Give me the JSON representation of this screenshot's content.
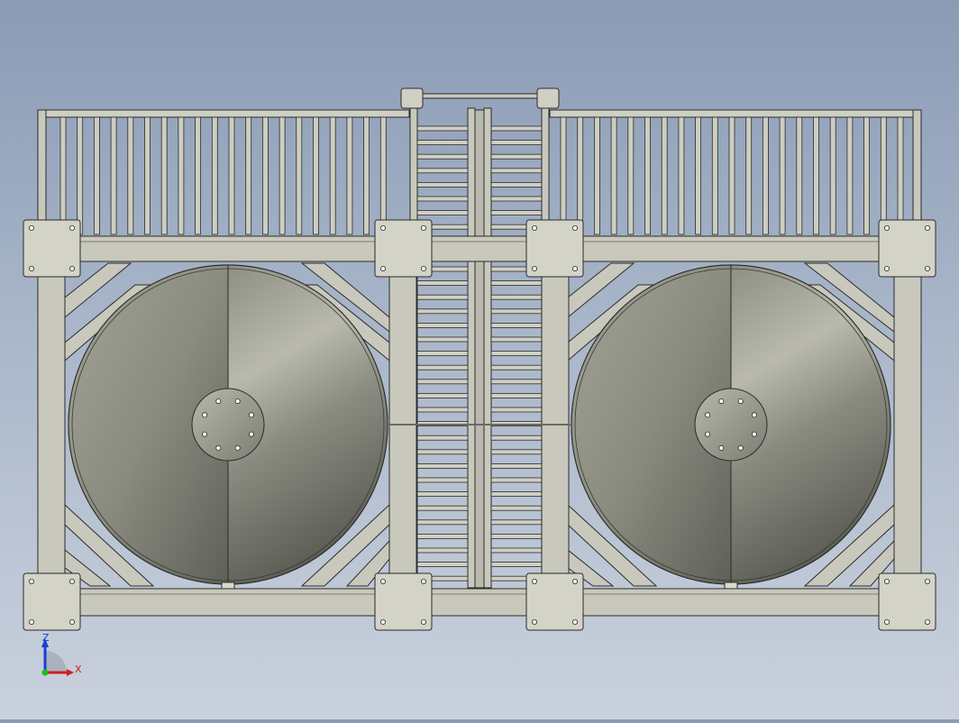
{
  "view": {
    "background_top": "#8a9bb5",
    "background_bottom": "#c9d1dd",
    "metal_color": "#c9c9bb",
    "edge_color": "#2b2b2b",
    "disc_light": "#b3b3a6",
    "disc_dark": "#6e6f65"
  },
  "triad": {
    "z_label": "Z",
    "x_label": "X",
    "z_color": "#1b3fd6",
    "x_color": "#d41c1c",
    "origin_color": "#18c018"
  },
  "assembly": {
    "left_fan_icon": "fan-disc-icon",
    "right_fan_icon": "fan-disc-icon",
    "railing_icon": "railing-icon",
    "ladder_icon": "ladder-icon"
  }
}
